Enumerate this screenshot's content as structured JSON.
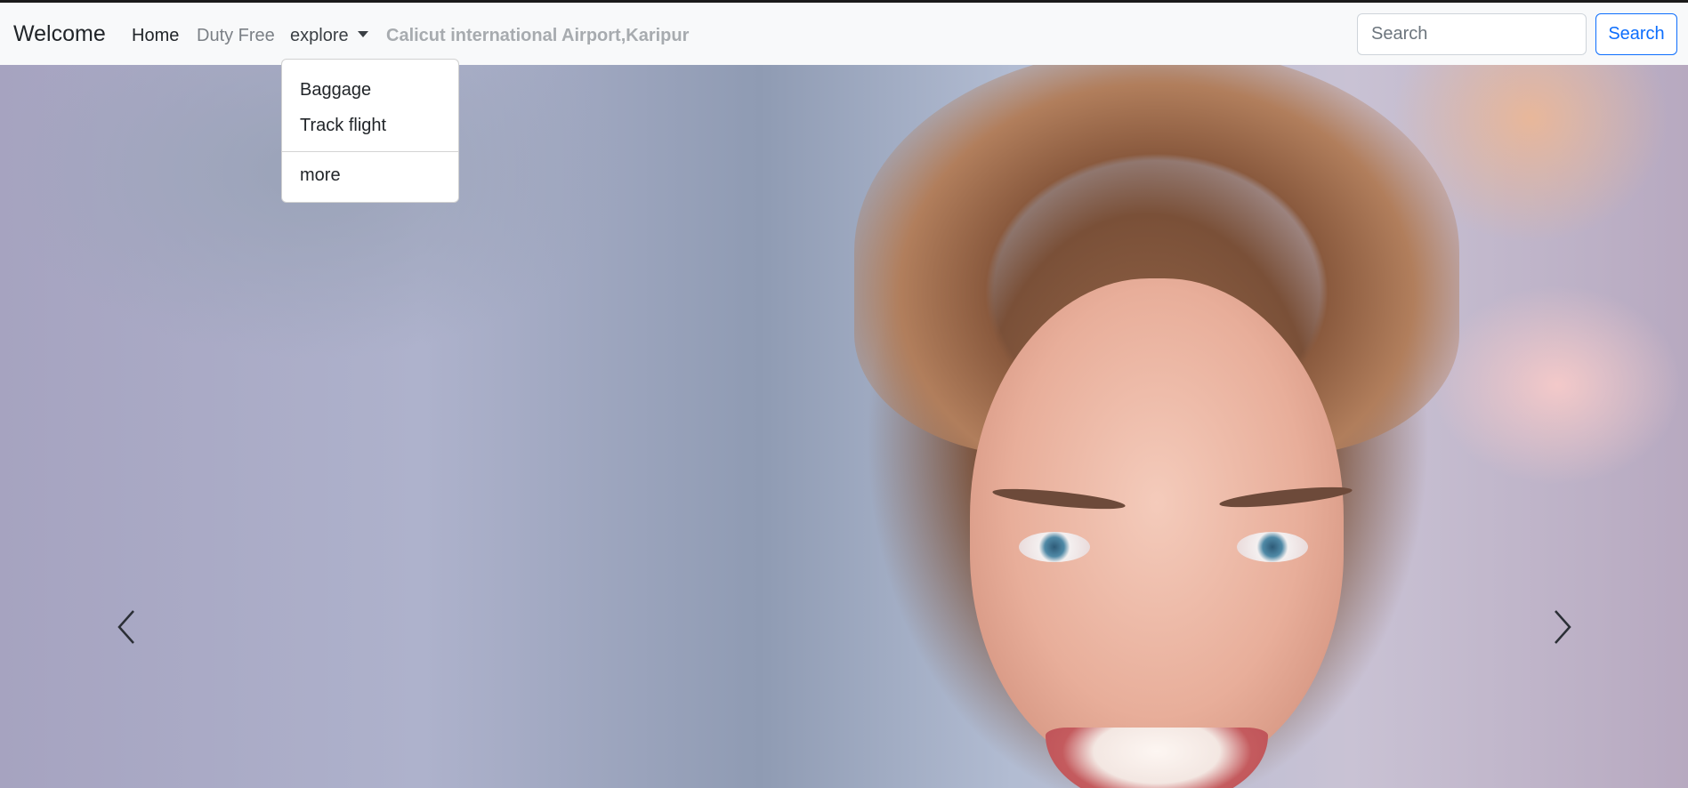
{
  "navbar": {
    "brand": "Welcome",
    "links": {
      "home": "Home",
      "duty_free": "Duty Free",
      "explore": "explore"
    },
    "airport_name": "Calicut international Airport,Karipur",
    "search": {
      "placeholder": "Search",
      "button_label": "Search"
    }
  },
  "explore_menu": {
    "items": [
      "Baggage",
      "Track flight"
    ],
    "more": "more"
  },
  "carousel": {
    "prev_icon": "chevron-left-icon",
    "next_icon": "chevron-right-icon",
    "slide_image": "smiling-woman-photo"
  },
  "colors": {
    "navbar_bg": "#f8f9fa",
    "primary": "#0d6efd",
    "muted_link": "#7b8086"
  }
}
